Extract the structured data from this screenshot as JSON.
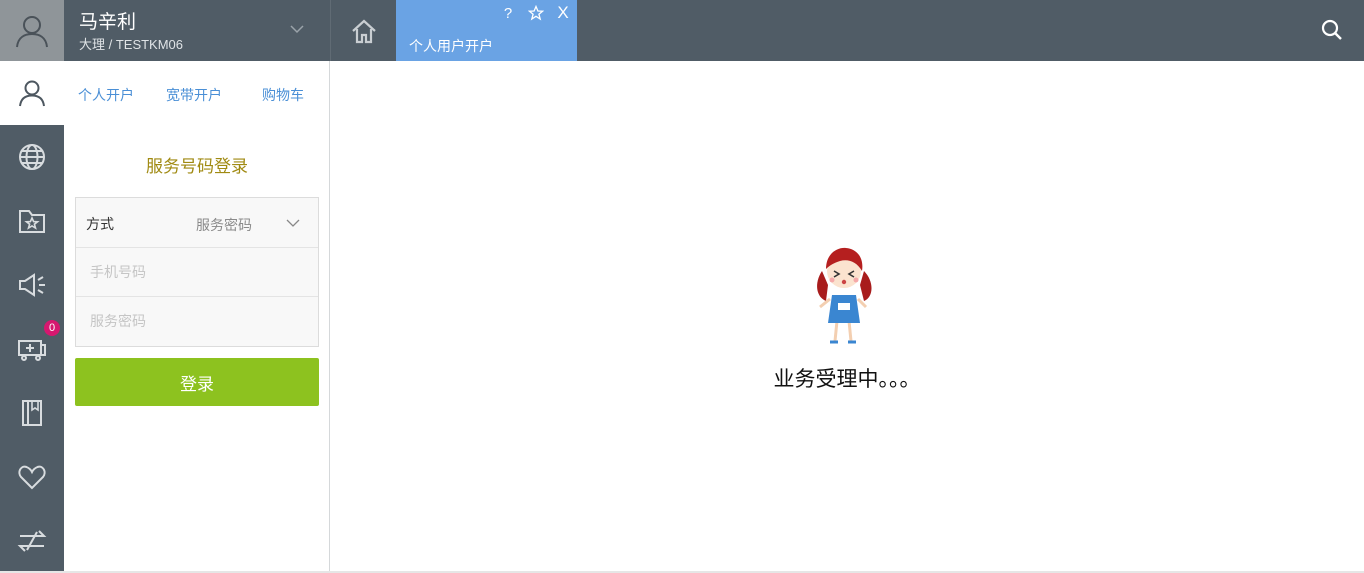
{
  "user": {
    "name": "马辛利",
    "sub": "大理 / TESTKM06"
  },
  "tabs": [
    {
      "label": "个人用户开户",
      "active": true
    }
  ],
  "tab_actions": {
    "help": "?",
    "close": "X"
  },
  "sidebar": {
    "items": [
      {
        "icon": "user-icon",
        "active": true
      },
      {
        "icon": "globe-icon"
      },
      {
        "icon": "folder-star-icon"
      },
      {
        "icon": "megaphone-icon"
      },
      {
        "icon": "cart-plus-icon",
        "badge": "0"
      },
      {
        "icon": "book-icon"
      },
      {
        "icon": "heart-icon"
      },
      {
        "icon": "switch-icon"
      }
    ]
  },
  "panel": {
    "subtabs": [
      "个人开户",
      "宽带开户",
      "购物车"
    ],
    "login_title": "服务号码登录",
    "method_label": "方式",
    "method_value": "服务密码",
    "phone_placeholder": "手机号码",
    "password_placeholder": "服务密码",
    "login_button": "登录"
  },
  "main": {
    "processing_text": "业务受理中。。。"
  },
  "colors": {
    "topbar": "#505c66",
    "active_tab": "#6aa3e4",
    "login_button": "#8dc21f",
    "link": "#4a8fd6",
    "title_gold": "#a08a12",
    "badge": "#d6176f"
  }
}
